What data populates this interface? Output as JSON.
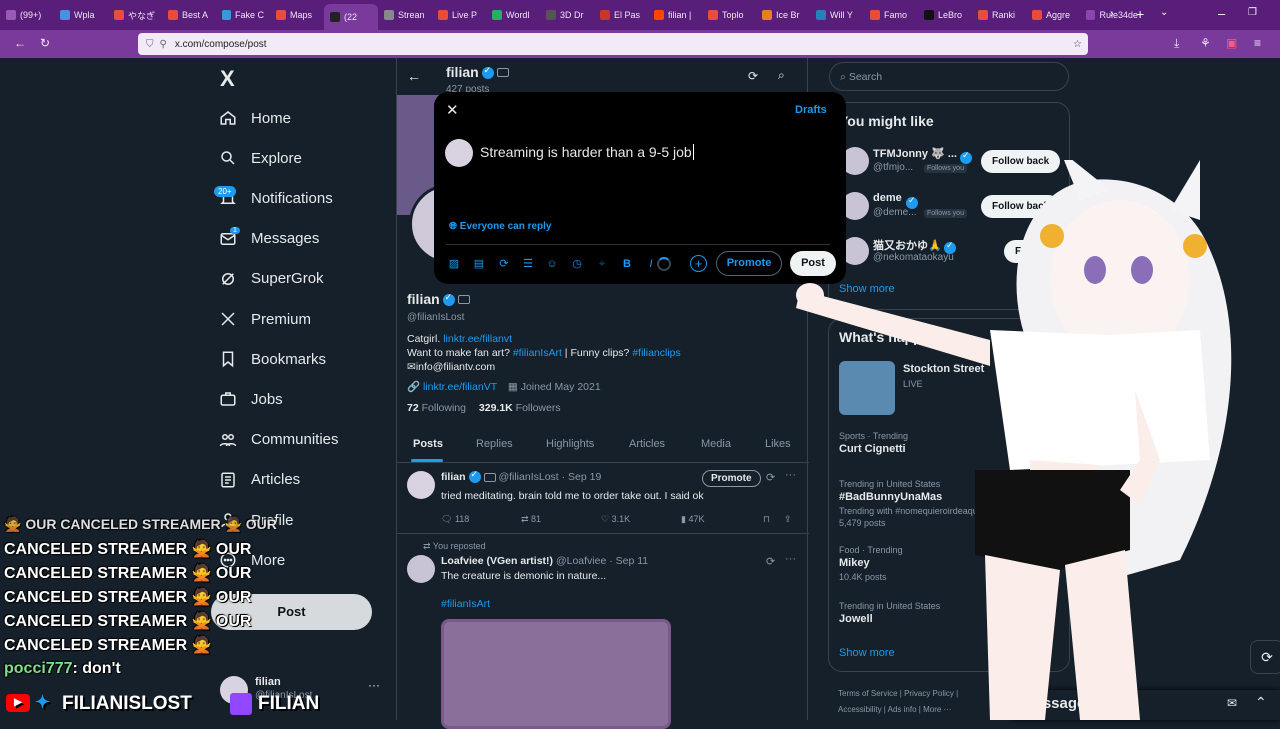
{
  "browser": {
    "tabs": [
      "(99+)",
      "Wpla",
      "やなぎ",
      "Best A",
      "Fake C",
      "Maps",
      "(22",
      "Strean",
      "Live P",
      "Wordl",
      "3D Dr",
      "El Pas",
      "filian |",
      "Toplo",
      "Ice Br",
      "Will Y",
      "Famo",
      "LeBro",
      "Ranki",
      "Aggre",
      "Rule34de"
    ],
    "url": "x.com/compose/post"
  },
  "nav": {
    "logo": "X",
    "items": [
      "Home",
      "Explore",
      "Notifications",
      "Messages",
      "SuperGrok",
      "Premium",
      "Bookmarks",
      "Jobs",
      "Communities",
      "Articles",
      "Profile",
      "More"
    ],
    "notif_badge": "20+",
    "msg_badge": "1",
    "post_button": "Post",
    "account_name": "filian",
    "account_handle": "@filianIsLost"
  },
  "profile": {
    "header_name": "filian",
    "header_posts": "427 posts",
    "name": "filian",
    "handle": "@filianIsLost",
    "bio_line1_text": "Catgirl.",
    "bio_line1_link": "linktr.ee/fillanvt",
    "bio_line2_text": "Want to make fan art?",
    "bio_line2_tag1": "#filianIsArt",
    "bio_line2_mid": "| Funny clips?",
    "bio_line2_tag2": "#filianclips",
    "bio_line3": "info@filiantv.com",
    "link": "linktr.ee/filianVT",
    "joined": "Joined May 2021",
    "following_count": "72",
    "following_label": "Following",
    "followers_count": "329.1K",
    "followers_label": "Followers",
    "tabs": [
      "Posts",
      "Replies",
      "Highlights",
      "Articles",
      "Media",
      "Likes"
    ]
  },
  "posts": [
    {
      "name": "filian",
      "meta": "@filianIsLost · Sep 19",
      "promote": "Promote",
      "text": "tried meditating. brain told me to order take out. I said ok",
      "replies": "118",
      "reposts": "81",
      "likes": "3.1K",
      "views": "47K"
    },
    {
      "reposted": "You reposted",
      "name": "Loafviee (VGen artist!)",
      "meta": "@Loafviee · Sep 11",
      "text": "The creature is demonic in nature...",
      "tag": "#filianIsArt"
    }
  ],
  "compose": {
    "drafts": "Drafts",
    "text": "Streaming is harder than a 9-5 job",
    "reply_setting": "Everyone can reply",
    "promote": "Promote",
    "post": "Post"
  },
  "right": {
    "search_placeholder": "Search",
    "might_like_title": "You might like",
    "suggestions": [
      {
        "name": "TFMJonny 🐺 ...",
        "handle": "@tfmjo...",
        "follows": "Follows you",
        "btn": "Follow back"
      },
      {
        "name": "deme",
        "handle": "@deme...",
        "follows": "Follows you",
        "btn": "Follow back"
      },
      {
        "name": "猫又おかゆ🙏",
        "handle": "@nekomataokayu",
        "follows": "",
        "btn": "Follow"
      }
    ],
    "show_more": "Show more",
    "happening_title": "What's happening",
    "live_title": "Stockton Street",
    "live_label": "LIVE",
    "trends": [
      {
        "ctx": "Sports · Trending",
        "name": "Curt Cignetti",
        "extra": ""
      },
      {
        "ctx": "Trending in United States",
        "name": "#BadBunnyUnaMas",
        "extra": "Trending with #nomequieroirdeaqu"
      },
      {
        "ctx": "",
        "name": "",
        "extra": "5,479 posts"
      },
      {
        "ctx": "Food · Trending",
        "name": "Mikey",
        "extra": "10.4K posts"
      },
      {
        "ctx": "Trending in United States",
        "name": "Jowell",
        "extra": ""
      }
    ],
    "show_more2": "Show more",
    "footer": "Terms of Service | Privacy Policy | Accessibility | Ads info | More ···",
    "messages": "Message"
  },
  "overlay": {
    "chat_lines": [
      "CANCELED STREAMER 🙅 OUR",
      "CANCELED STREAMER 🙅 OUR",
      "CANCELED STREAMER 🙅 OUR",
      "CANCELED STREAMER 🙅 OUR",
      "CANCELED STREAMER 🙅"
    ],
    "chat_top": "🙅 OUR CANCELED STREAMER 🙅 OUR",
    "chat_user": "pocci777",
    "chat_msg": ": don't",
    "banner_left": "FILIANISLOST",
    "banner_right": "FILIAN"
  },
  "colors": {
    "accent": "#1d9bf0",
    "bg": "#15202b",
    "chrome": "#581e7a"
  }
}
